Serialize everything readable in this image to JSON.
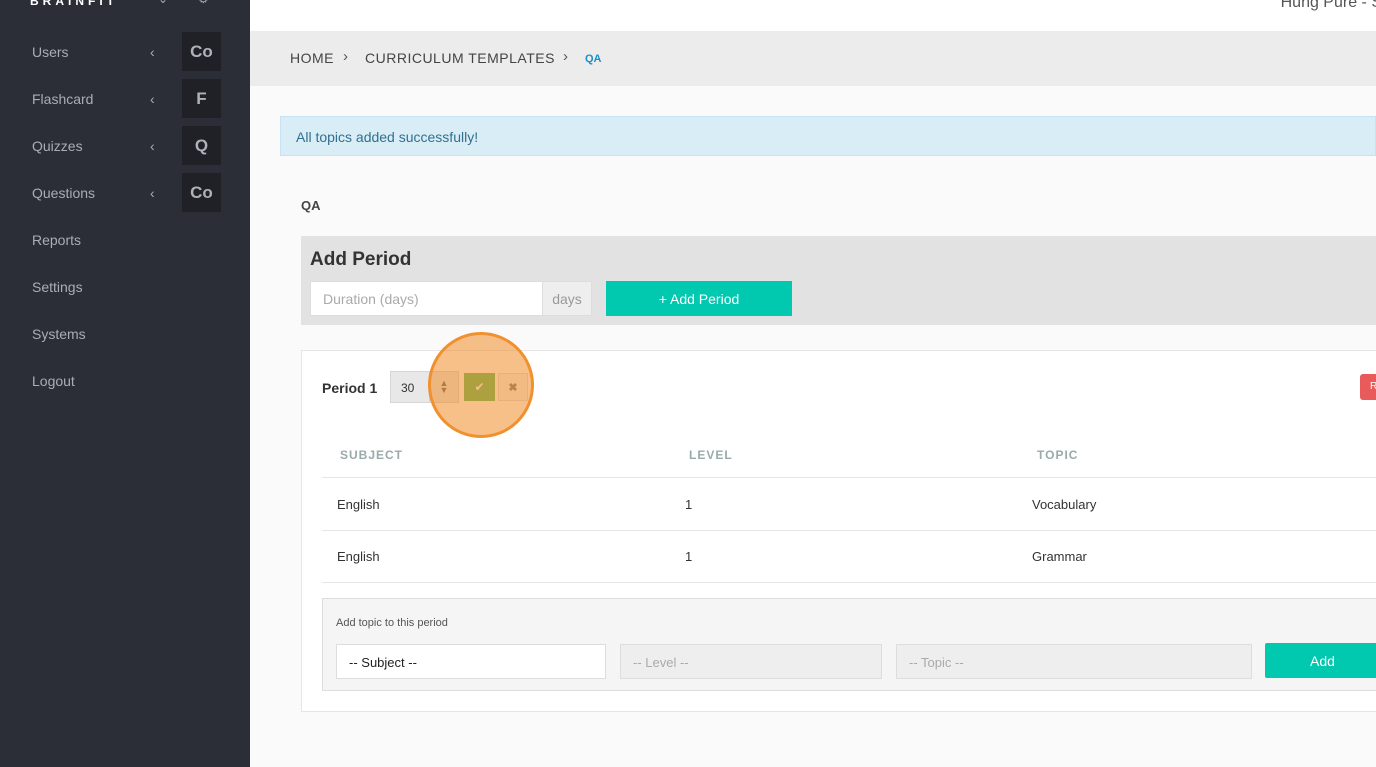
{
  "sidebar": {
    "brand": "BRAINFIT",
    "brand_caret": "⌄",
    "brand_gear": "⚙",
    "items": [
      {
        "label": "Users",
        "chevron": "‹",
        "badge": "Co"
      },
      {
        "label": "Flashcard",
        "chevron": "‹",
        "badge": "F"
      },
      {
        "label": "Quizzes",
        "chevron": "‹",
        "badge": "Q"
      },
      {
        "label": "Questions",
        "chevron": "‹",
        "badge": "Co"
      },
      {
        "label": "Reports"
      },
      {
        "label": "Settings"
      },
      {
        "label": "Systems"
      },
      {
        "label": "Logout"
      }
    ]
  },
  "header": {
    "user_name": "Hung Pure - S"
  },
  "breadcrumb": {
    "home": "HOME",
    "templates": "CURRICULUM TEMPLATES",
    "current": "QA",
    "separator": "›"
  },
  "alert": {
    "text": "All topics added successfully!"
  },
  "page": {
    "subtitle": "QA"
  },
  "add_period": {
    "title": "Add Period",
    "duration_placeholder": "Duration (days)",
    "days_addon": "days",
    "button_label": "+ Add Period"
  },
  "period": {
    "label": "Period 1",
    "days_value": "30",
    "spin_up": "▲",
    "spin_down": "▼",
    "ok_icon": "✔",
    "cancel_icon": "✖",
    "remove_label": "R",
    "columns": [
      "SUBJECT",
      "LEVEL",
      "TOPIC"
    ],
    "rows": [
      {
        "subject": "English",
        "level": "1",
        "topic": "Vocabulary"
      },
      {
        "subject": "English",
        "level": "1",
        "topic": "Grammar"
      }
    ]
  },
  "add_topic": {
    "label": "Add topic to this period",
    "subject_value": "-- Subject --",
    "level_value": "-- Level --",
    "topic_value": "-- Topic --",
    "button_label": "Add"
  },
  "colors": {
    "sidebar_bg": "#2b2e36",
    "accent_teal": "#00c9b0",
    "alert_bg": "#d9edf7",
    "success_green": "#5cb85c",
    "danger_red": "#e95a5a",
    "highlight_orange": "#f0902f"
  }
}
